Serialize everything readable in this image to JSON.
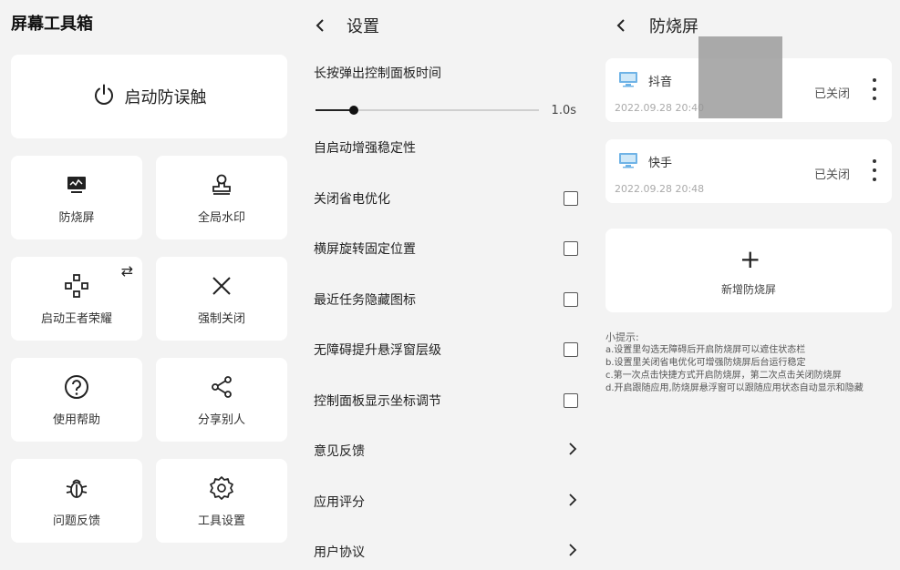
{
  "panel1": {
    "title": "屏幕工具箱",
    "launch_label": "启动防误触",
    "tiles": [
      {
        "label": "防烧屏",
        "icon": "monitor-icon"
      },
      {
        "label": "全局水印",
        "icon": "stamp-icon"
      },
      {
        "label": "启动王者荣耀",
        "icon": "gamepad-icon"
      },
      {
        "label": "强制关闭",
        "icon": "close-icon"
      },
      {
        "label": "使用帮助",
        "icon": "help-icon"
      },
      {
        "label": "分享别人",
        "icon": "share-icon"
      },
      {
        "label": "问题反馈",
        "icon": "bug-icon"
      },
      {
        "label": "工具设置",
        "icon": "gear-icon"
      }
    ]
  },
  "panel2": {
    "title": "设置",
    "slider_label": "长按弹出控制面板时间",
    "slider_value": "1.0s",
    "slider_fraction": 0.17,
    "rows": [
      {
        "label": "自启动增强稳定性",
        "control": "none"
      },
      {
        "label": "关闭省电优化",
        "control": "checkbox"
      },
      {
        "label": "横屏旋转固定位置",
        "control": "checkbox"
      },
      {
        "label": "最近任务隐藏图标",
        "control": "checkbox"
      },
      {
        "label": "无障碍提升悬浮窗层级",
        "control": "checkbox"
      },
      {
        "label": "控制面板显示坐标调节",
        "control": "checkbox"
      },
      {
        "label": "意见反馈",
        "control": "chevron"
      },
      {
        "label": "应用评分",
        "control": "chevron"
      },
      {
        "label": "用户协议",
        "control": "chevron"
      }
    ]
  },
  "panel3": {
    "title": "防烧屏",
    "apps": [
      {
        "name": "抖音",
        "time": "2022.09.28 20:40",
        "status": "已关闭"
      },
      {
        "name": "快手",
        "time": "2022.09.28 20:48",
        "status": "已关闭"
      }
    ],
    "add_label": "新增防烧屏",
    "add_symbol": "+",
    "tips_title": "小提示:",
    "tips": [
      "a.设置里勾选无障碍后开启防烧屏可以遮住状态栏",
      "b.设置里关闭省电优化可增强防烧屏后台运行稳定",
      "c.第一次点击快捷方式开启防烧屏，第二次点击关闭防烧屏",
      "d.开启跟随应用,防烧屏悬浮窗可以跟随应用状态自动显示和隐藏"
    ]
  }
}
